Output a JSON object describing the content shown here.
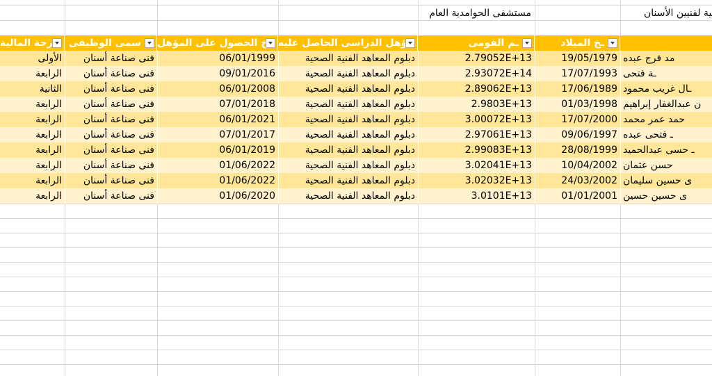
{
  "sheet": {
    "top_cells": {
      "hospital": "مستشفى الحوامدية العام",
      "title_fragment": "الية لفنيين الأسنان"
    },
    "headers": {
      "financial_grade": "رجة المالية",
      "job_title": "سمى الوظيفى",
      "qual_date": "ـخ الحصول على المؤهل",
      "qualification": "ؤهل الدراسى الحاصل عليه",
      "national_id": "ـم القومى",
      "birth_date": "ـخ الميلاد"
    },
    "rows": [
      {
        "grade": "الأولى",
        "job": "فنى صناعة أسنان",
        "qdate": "06/01/1999",
        "qual": "دبلوم المعاهد الفنية الصحية",
        "nid": "2.79052E+13",
        "bdate": "19/05/1979",
        "name": "مد فرج عبده"
      },
      {
        "grade": "الرابعة",
        "job": "فنى صناعة أسنان",
        "qdate": "09/01/2016",
        "qual": "دبلوم المعاهد الفنية الصحية",
        "nid": "2.93072E+14",
        "bdate": "17/07/1993",
        "name": "ـة فتحى"
      },
      {
        "grade": "الثانية",
        "job": "فنى صناعة أسنان",
        "qdate": "06/01/2008",
        "qual": "دبلوم المعاهد الفنية الصحية",
        "nid": "2.89062E+13",
        "bdate": "17/06/1989",
        "name": "ـال غريب محمود"
      },
      {
        "grade": "الرابعة",
        "job": "فنى صناعة أسنان",
        "qdate": "07/01/2018",
        "qual": "دبلوم المعاهد الفنية الصحية",
        "nid": "2.9803E+13",
        "bdate": "01/03/1998",
        "name": "ن عبدالغفار إبراهيم"
      },
      {
        "grade": "الرابعة",
        "job": "فنى صناعة أسنان",
        "qdate": "06/01/2021",
        "qual": "دبلوم المعاهد الفنية الصحية",
        "nid": "3.00072E+13",
        "bdate": "17/07/2000",
        "name": "حمد عمر محمد"
      },
      {
        "grade": "الرابعة",
        "job": "فنى صناعة أسنان",
        "qdate": "07/01/2017",
        "qual": "دبلوم المعاهد الفنية الصحية",
        "nid": "2.97061E+13",
        "bdate": "09/06/1997",
        "name": "ـ فتحى عبده"
      },
      {
        "grade": "الرابعة",
        "job": "فنى صناعة أسنان",
        "qdate": "06/01/2019",
        "qual": "دبلوم المعاهد الفنية الصحية",
        "nid": "2.99083E+13",
        "bdate": "28/08/1999",
        "name": "ـ حسى عبدالحميد"
      },
      {
        "grade": "الرابعة",
        "job": "فنى صناعة أسنان",
        "qdate": "01/06/2022",
        "qual": "دبلوم المعاهد الفنية الصحية",
        "nid": "3.02041E+13",
        "bdate": "10/04/2002",
        "name": "حسن عثمان"
      },
      {
        "grade": "الرابعة",
        "job": "فنى صناعة أسنان",
        "qdate": "01/06/2022",
        "qual": "دبلوم المعاهد الفنية الصحية",
        "nid": "3.02032E+13",
        "bdate": "24/03/2002",
        "name": "ى حسين سليمان"
      },
      {
        "grade": "الرابعة",
        "job": "فنى صناعة أسنان",
        "qdate": "01/06/2020",
        "qual": "دبلوم المعاهد الفنية الصحية",
        "nid": "3.0101E+13",
        "bdate": "01/01/2001",
        "name": "ى حسين حسين"
      }
    ]
  }
}
